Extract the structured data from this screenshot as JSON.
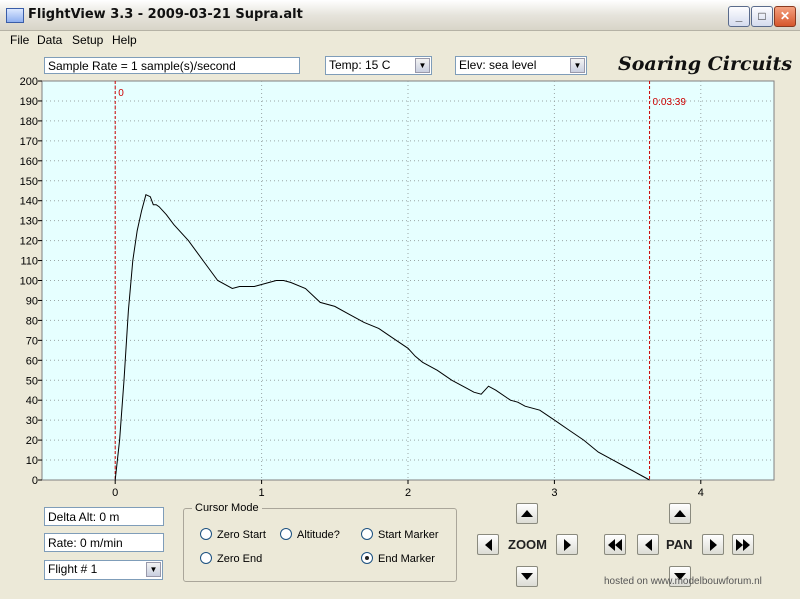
{
  "window": {
    "title": "FlightView 3.3 - 2009-03-21 Supra.alt",
    "minimize": "_",
    "maximize": "□",
    "close": "✕"
  },
  "menu": [
    "File",
    "Data",
    "Setup",
    "Help"
  ],
  "toolbar": {
    "sample_rate": "Sample Rate =  1 sample(s)/second",
    "temp": "Temp:  15 C",
    "elev": "Elev: sea level",
    "brand": "Soaring Circuits"
  },
  "chart_data": {
    "type": "line",
    "x": [
      0,
      0.03,
      0.06,
      0.09,
      0.12,
      0.15,
      0.18,
      0.21,
      0.24,
      0.26,
      0.28,
      0.3,
      0.35,
      0.4,
      0.5,
      0.6,
      0.7,
      0.8,
      0.85,
      0.9,
      0.95,
      1.0,
      1.05,
      1.1,
      1.15,
      1.2,
      1.3,
      1.4,
      1.5,
      1.6,
      1.7,
      1.8,
      1.9,
      2.0,
      2.05,
      2.1,
      2.2,
      2.3,
      2.4,
      2.45,
      2.5,
      2.55,
      2.6,
      2.7,
      2.75,
      2.8,
      2.9,
      3.0,
      3.1,
      3.2,
      3.3,
      3.4,
      3.5,
      3.6,
      3.65
    ],
    "y": [
      0,
      20,
      50,
      85,
      110,
      125,
      135,
      143,
      142,
      138,
      138,
      137,
      133,
      128,
      120,
      110,
      100,
      96,
      97,
      97,
      97,
      98,
      99,
      100,
      100,
      99,
      96,
      89,
      87,
      83,
      79,
      76,
      71,
      66,
      62,
      59,
      55,
      50,
      46,
      44,
      43,
      47,
      45,
      40,
      39,
      37,
      35,
      30,
      25,
      20,
      14,
      10,
      6,
      2,
      0
    ],
    "xlim": [
      -0.5,
      4.5
    ],
    "ylim": [
      0,
      200
    ],
    "xticks": [
      "0",
      "1",
      "2",
      "3",
      "4"
    ],
    "xtick_values": [
      0,
      1,
      2,
      3,
      4
    ],
    "yticks": [
      0,
      10,
      20,
      30,
      40,
      50,
      60,
      70,
      80,
      90,
      100,
      110,
      120,
      130,
      140,
      150,
      160,
      170,
      180,
      190,
      200
    ],
    "grid": true,
    "start_marker": {
      "x": 0,
      "label": "0"
    },
    "end_marker": {
      "x": 3.65,
      "label": "0:03:39"
    },
    "colors": {
      "background": "#e6ffff",
      "line": "#000000",
      "marker": "#cc0000",
      "grid": "#9aa6a6"
    }
  },
  "readouts": {
    "delta_alt": "Delta Alt: 0 m",
    "rate": "Rate: 0 m/min",
    "flight": "Flight # 1"
  },
  "cursor_mode": {
    "title": "Cursor Mode",
    "options": [
      "Zero Start",
      "Altitude?",
      "Start Marker",
      "Zero End",
      "End Marker"
    ],
    "selected": "End Marker"
  },
  "nav": {
    "zoom": "ZOOM",
    "pan": "PAN"
  },
  "watermark": "hosted on www.modelbouwforum.nl"
}
